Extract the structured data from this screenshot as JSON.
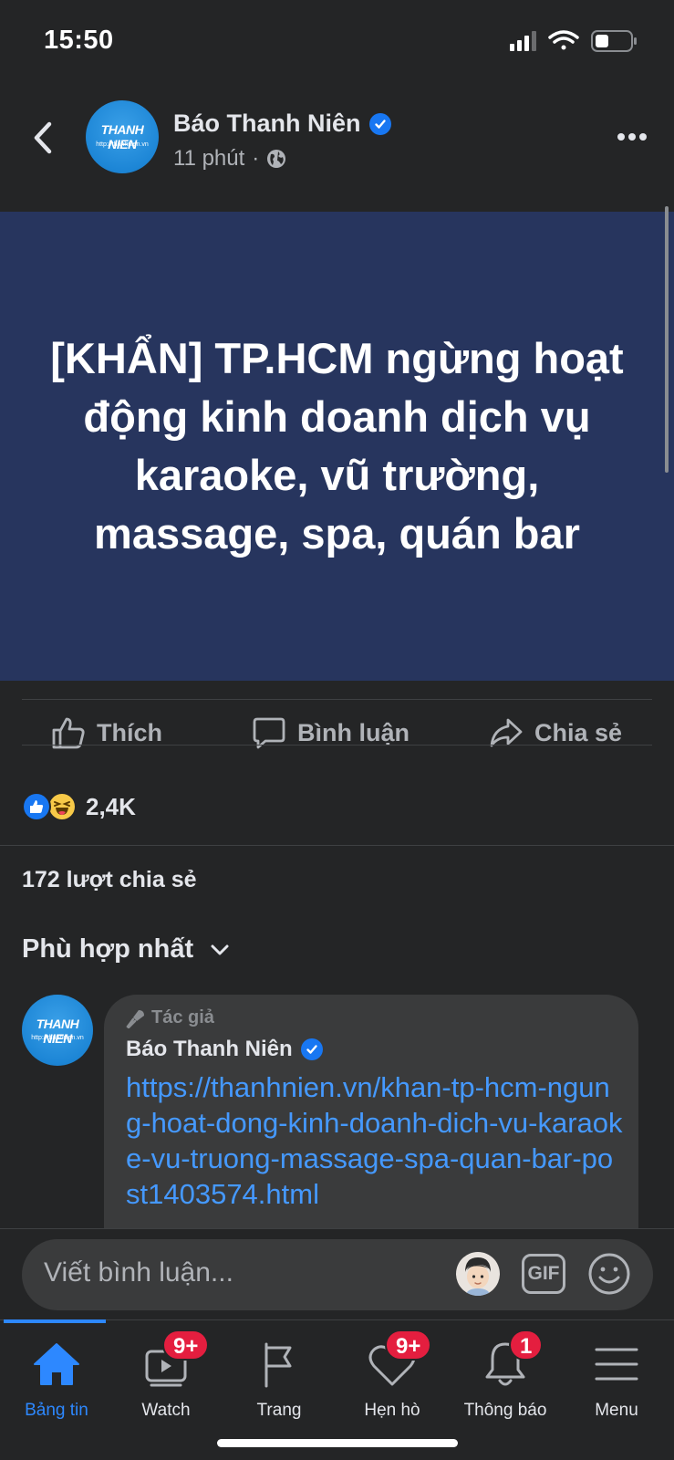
{
  "status_bar": {
    "time": "15:50"
  },
  "post": {
    "page_name": "Báo Thanh Niên",
    "time_ago": "11 phút",
    "avatar_brand": "THANH NIEN",
    "avatar_url": "http://thanhnien.vn",
    "headline": "[KHẨN] TP.HCM ngừng hoạt động kinh doanh dịch vụ karaoke, vũ trường, massage, spa, quán bar"
  },
  "actions": {
    "like": "Thích",
    "comment": "Bình luận",
    "share": "Chia sẻ"
  },
  "reactions": {
    "count": "2,4K"
  },
  "shares_text": "172 lượt chia sẻ",
  "sort_label": "Phù hợp nhất",
  "comment": {
    "author_tag": "Tác giả",
    "name": "Báo Thanh Niên",
    "link": "https://thanhnien.vn/khan-tp-hcm-ngung-hoat-dong-kinh-doanh-dich-vu-karaoke-vu-truong-massage-spa-quan-bar-post1403574.html"
  },
  "composer": {
    "placeholder": "Viết bình luận...",
    "gif": "GIF"
  },
  "tabs": [
    {
      "label": "Bảng tin",
      "icon": "home-icon",
      "badge": ""
    },
    {
      "label": "Watch",
      "icon": "watch-icon",
      "badge": "9+"
    },
    {
      "label": "Trang",
      "icon": "flag-icon",
      "badge": ""
    },
    {
      "label": "Hẹn hò",
      "icon": "heart-icon",
      "badge": "9+"
    },
    {
      "label": "Thông báo",
      "icon": "bell-icon",
      "badge": "1"
    },
    {
      "label": "Menu",
      "icon": "menu-icon",
      "badge": ""
    }
  ],
  "colors": {
    "background": "#242526",
    "accent": "#2d88ff",
    "post_card": "#27355e",
    "link": "#4599ff",
    "badge": "#e41e3f"
  }
}
